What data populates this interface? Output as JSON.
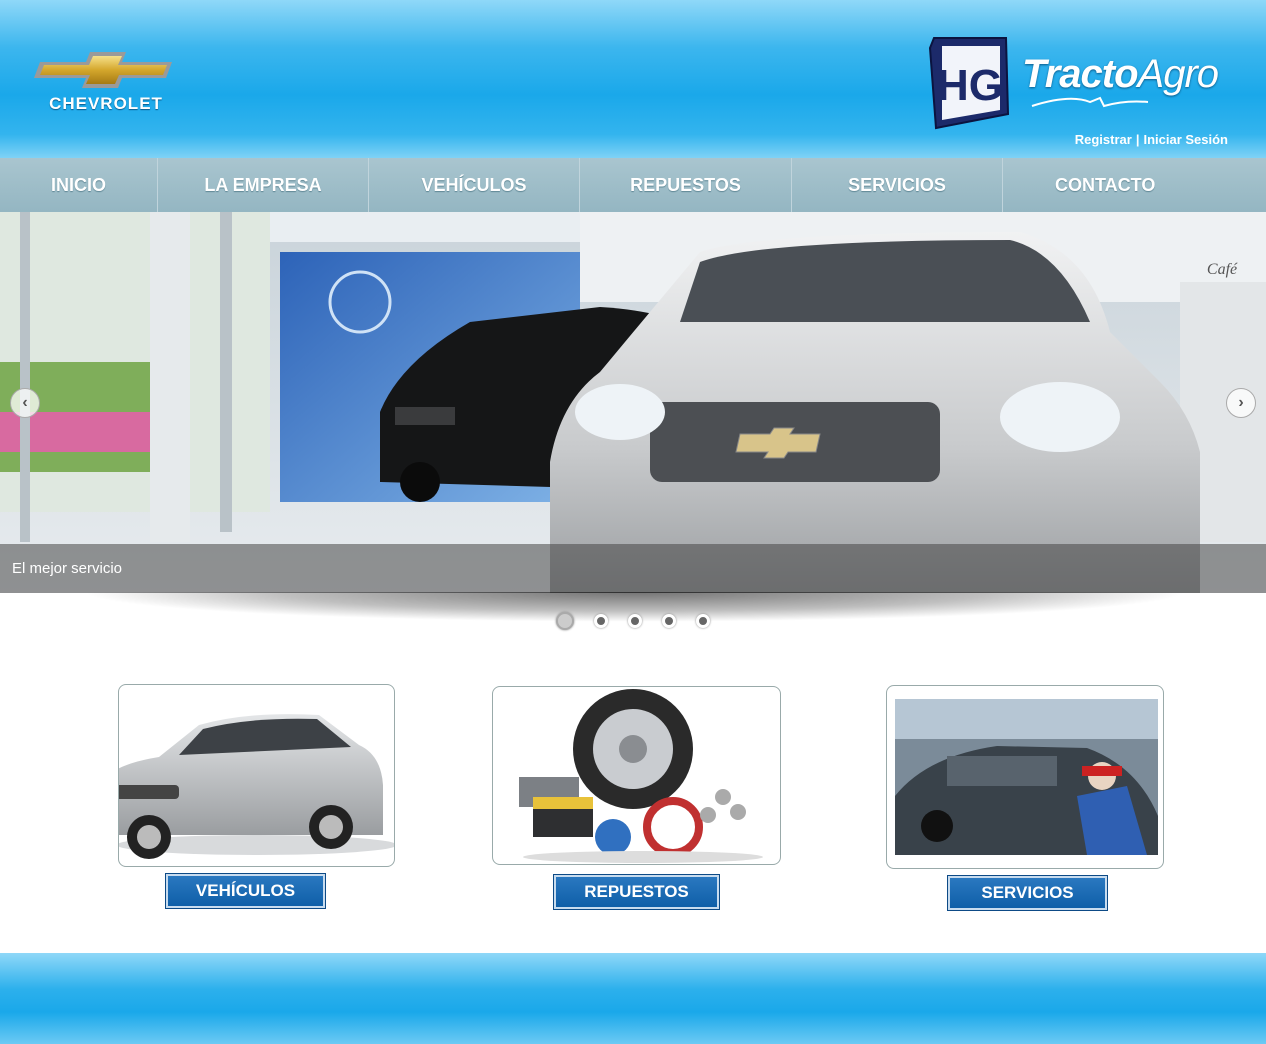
{
  "header": {
    "brand_left": "CHEVROLET",
    "brand_right_bold": "Tracto",
    "brand_right_light": "Agro",
    "hg_mark": "HG",
    "auth": {
      "register": "Registrar",
      "separator": "|",
      "login": "Iniciar Sesión"
    }
  },
  "nav": {
    "items": [
      {
        "label": "INICIO"
      },
      {
        "label": "LA EMPRESA"
      },
      {
        "label": "VEHÍCULOS"
      },
      {
        "label": "REPUESTOS"
      },
      {
        "label": "SERVICIOS"
      },
      {
        "label": "CONTACTO"
      }
    ]
  },
  "slider": {
    "caption": "El mejor servicio",
    "prev_icon": "chevron-left-icon",
    "next_icon": "chevron-right-icon",
    "slide_count": 5,
    "active_slide": 1,
    "scene_sign": "Café"
  },
  "cards": [
    {
      "button": "VEHÍCULOS",
      "image": "sedan-car-image"
    },
    {
      "button": "REPUESTOS",
      "image": "auto-parts-image"
    },
    {
      "button": "SERVICIOS",
      "image": "service-workshop-image"
    }
  ],
  "colors": {
    "header_blue": "#1aa8ea",
    "nav_gray": "#94b6c2",
    "button_blue": "#0f5fa8"
  }
}
